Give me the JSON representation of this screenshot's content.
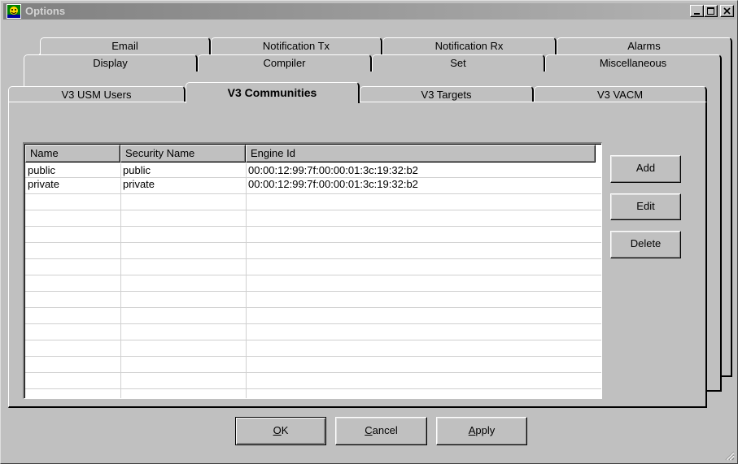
{
  "window": {
    "title": "Options",
    "minimize_glyph": "_",
    "maximize_glyph": "□",
    "close_glyph": "×"
  },
  "tabs": {
    "row1": [
      "Email",
      "Notification Tx",
      "Notification Rx",
      "Alarms"
    ],
    "row2": [
      "Display",
      "Compiler",
      "Set",
      "Miscellaneous"
    ],
    "row3": [
      "V3 USM Users",
      "V3 Communities",
      "V3 Targets",
      "V3 VACM"
    ],
    "active": "V3 Communities"
  },
  "table": {
    "columns": [
      "Name",
      "Security Name",
      "Engine Id"
    ],
    "rows": [
      [
        "public",
        "public",
        "00:00:12:99:7f:00:00:01:3c:19:32:b2"
      ],
      [
        "private",
        "private",
        "00:00:12:99:7f:00:00:01:3c:19:32:b2"
      ]
    ]
  },
  "side_buttons": {
    "add": "Add",
    "edit": "Edit",
    "delete": "Delete"
  },
  "footer_buttons": {
    "ok_mnemonic": "O",
    "ok_rest": "K",
    "cancel_mnemonic": "C",
    "cancel_rest": "ancel",
    "apply_mnemonic": "A",
    "apply_rest": "pply"
  },
  "icons": {
    "app": "options-app-icon",
    "minimize": "minimize-icon",
    "maximize": "maximize-icon",
    "close": "close-icon",
    "resize": "resize-grip-icon"
  }
}
